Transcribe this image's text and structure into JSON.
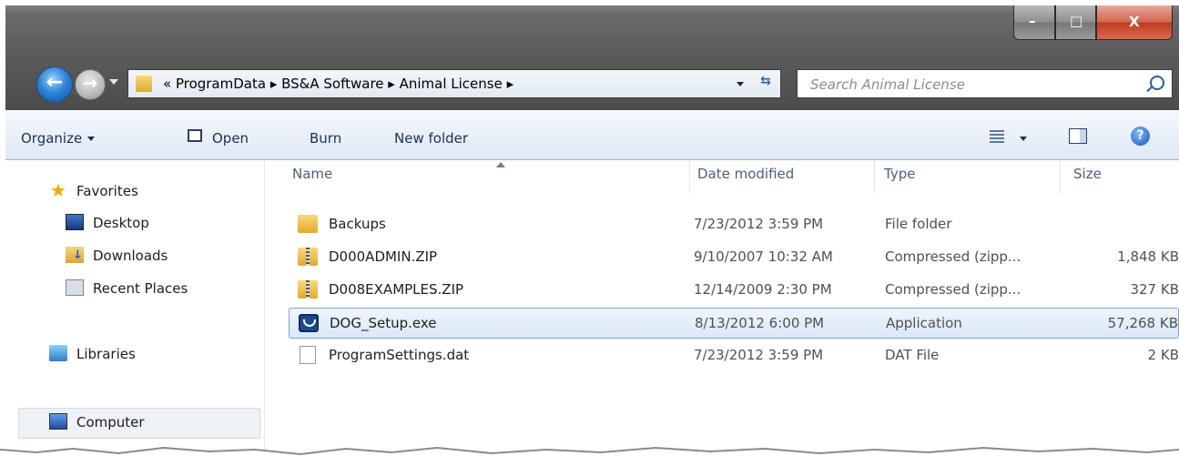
{
  "window": {
    "caption_buttons": {
      "minimize": "–",
      "maximize": "□",
      "close": "X"
    }
  },
  "navigation": {
    "back_icon": "back-arrow-icon",
    "forward_icon": "forward-arrow-icon",
    "address_text": "« ProgramData ▸ BS&A Software ▸ Animal License ▸",
    "search_placeholder": "Search Animal License"
  },
  "toolbar": {
    "organize_label": "Organize",
    "open_label": "Open",
    "burn_label": "Burn",
    "new_folder_label": "New folder"
  },
  "sidebar": {
    "favorites_label": "Favorites",
    "items": [
      {
        "label": "Desktop",
        "icon": "desktop-icon"
      },
      {
        "label": "Downloads",
        "icon": "downloads-icon"
      },
      {
        "label": "Recent Places",
        "icon": "recent-places-icon"
      }
    ],
    "libraries_label": "Libraries",
    "computer_label": "Computer"
  },
  "file_list": {
    "columns": [
      "Name",
      "Date modified",
      "Type",
      "Size"
    ],
    "rows": [
      {
        "name": "Backups",
        "date": "7/23/2012 3:59 PM",
        "type": "File folder",
        "size": "",
        "icon": "folder-icon"
      },
      {
        "name": "D000ADMIN.ZIP",
        "date": "9/10/2007 10:32 AM",
        "type": "Compressed (zipp...",
        "size": "1,848 KB",
        "icon": "zip-folder-icon"
      },
      {
        "name": "D008EXAMPLES.ZIP",
        "date": "12/14/2009 2:30 PM",
        "type": "Compressed (zipp...",
        "size": "327 KB",
        "icon": "zip-folder-icon"
      },
      {
        "name": "DOG_Setup.exe",
        "date": "8/13/2012 6:00 PM",
        "type": "Application",
        "size": "57,268 KB",
        "icon": "application-icon",
        "selected": true
      },
      {
        "name": "ProgramSettings.dat",
        "date": "7/23/2012 3:59 PM",
        "type": "DAT File",
        "size": "2 KB",
        "icon": "file-icon"
      }
    ]
  },
  "colors": {
    "titlebar": "#5b5b5b",
    "toolbar": "#e4ecf6",
    "selection": "#dbe8f7",
    "close_button": "#c8452a"
  }
}
